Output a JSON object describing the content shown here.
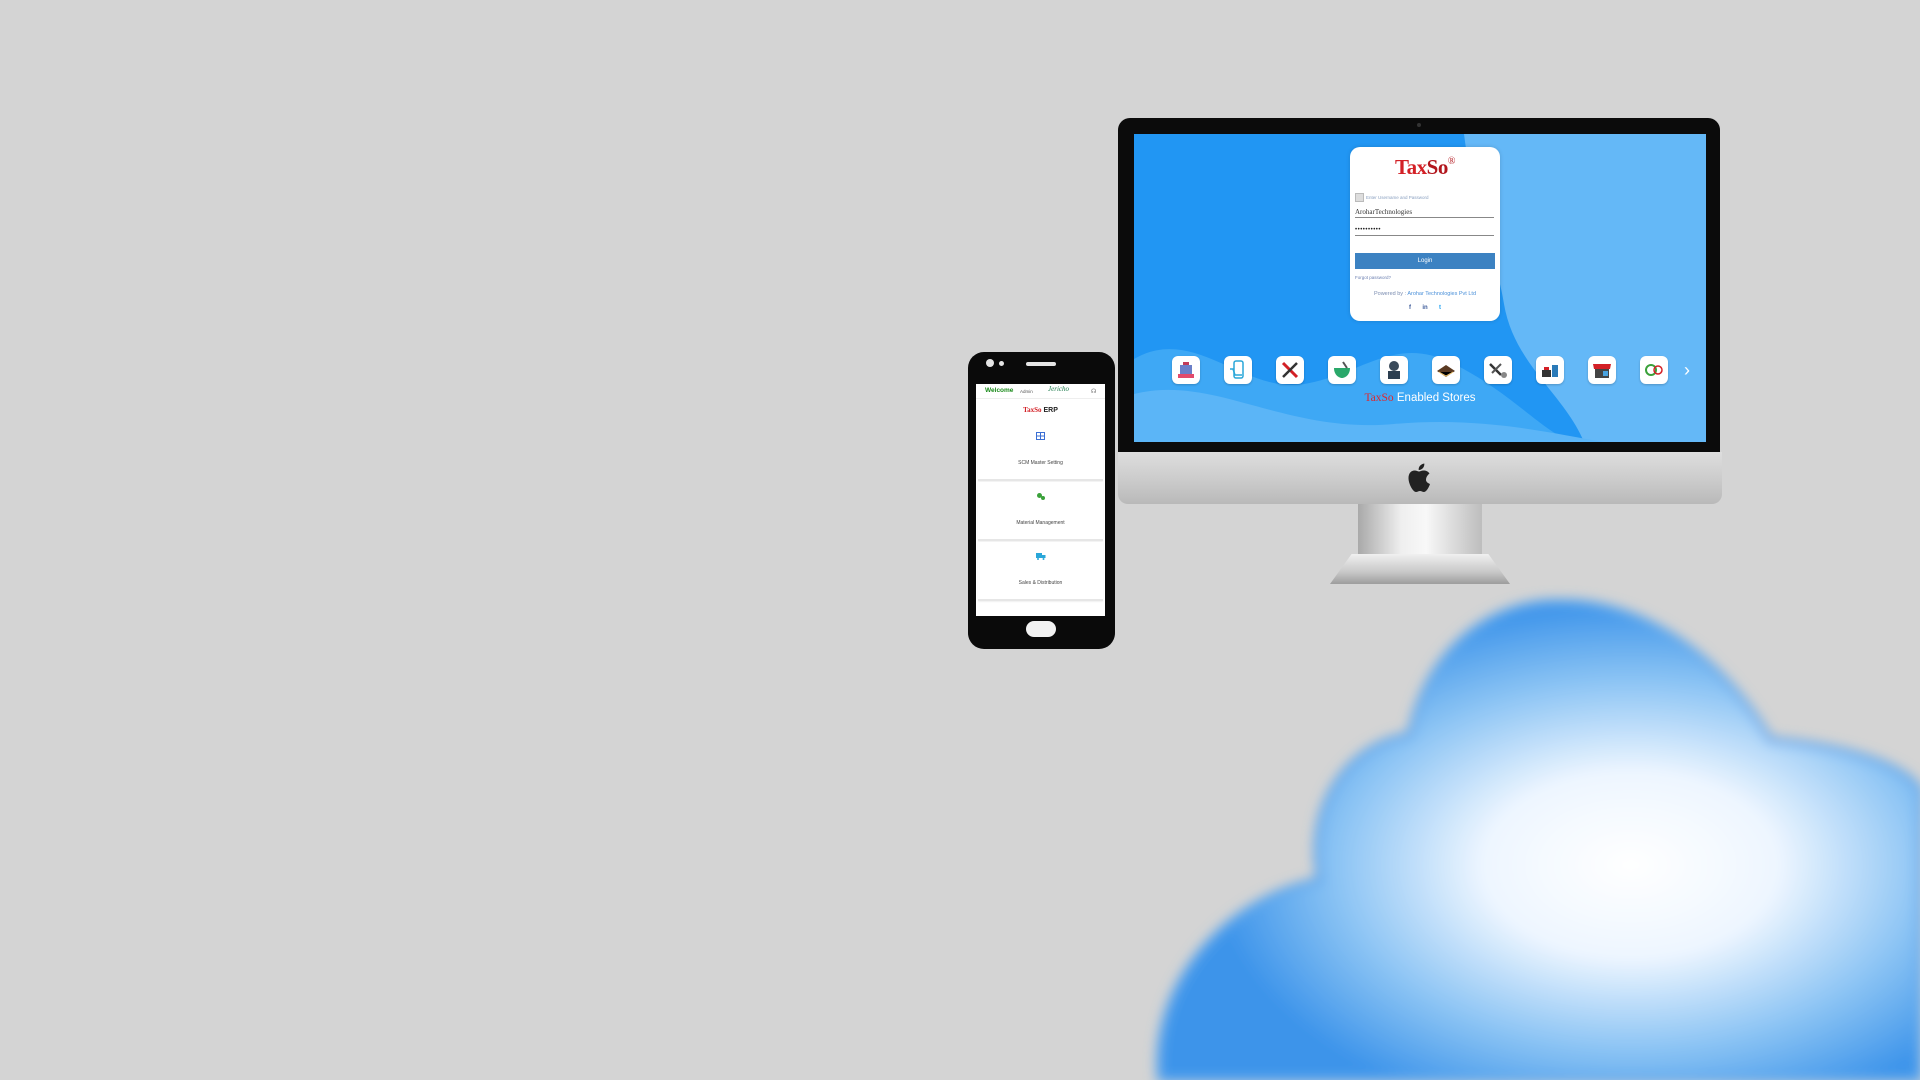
{
  "login": {
    "brand_tax": "Tax",
    "brand_so": "So",
    "brand_mark": "®",
    "hint": "Enter Username and Password",
    "username_value": "AroharTechnologies",
    "password_value": "••••••••••",
    "login_button": "Login",
    "forgot": "Forgot password?",
    "powered_prefix": "Powered by : ",
    "powered_org": "Arohar Technologies Pvt Ltd",
    "social": [
      "f",
      "in",
      "t"
    ]
  },
  "stores": {
    "caption_tax": "TaxSo",
    "caption_rest": " Enabled Stores",
    "next": "›",
    "icons": [
      "building-store-icon",
      "mobile-cart-icon",
      "tools-icon",
      "pharmacy-mortar-icon",
      "welding-worker-icon",
      "book-store-icon",
      "hardware-tools-icon",
      "furniture-store-icon",
      "market-stall-icon",
      "gift-icon"
    ]
  },
  "phone": {
    "welcome": "Welcome",
    "user": "Admin",
    "brand_right": "Jericho",
    "title_tax": "TaxSo",
    "title_rest": " ERP",
    "menu": [
      {
        "label": "SCM Master Setting",
        "icon": "grid-icon",
        "color": "#3b6fd4"
      },
      {
        "label": "Material Management",
        "icon": "gears-icon",
        "color": "#3aa13a"
      },
      {
        "label": "Sales & Distribution",
        "icon": "truck-icon",
        "color": "#2aa7d9"
      }
    ]
  },
  "colors": {
    "background": "#d4d4d4",
    "screen_blue": "#2196f3",
    "brand_red": "#d32026",
    "login_button": "#3c82c2",
    "welcome_green": "#1a8a1a"
  }
}
